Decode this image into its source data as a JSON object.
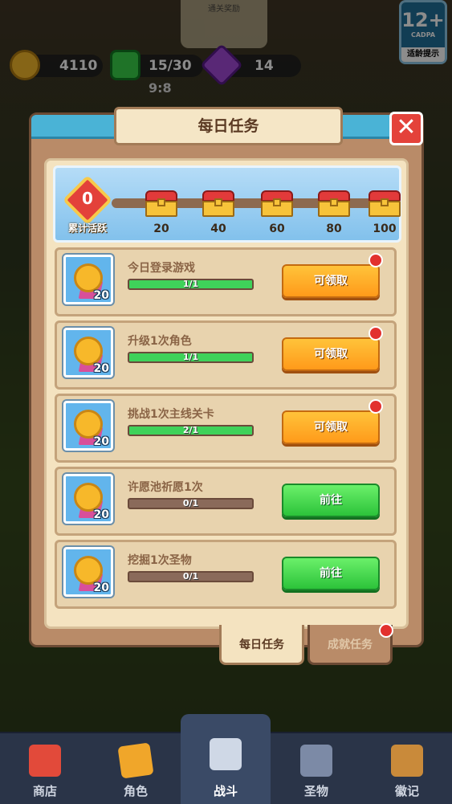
{
  "hud": {
    "gold": "4110",
    "energy": "15/30",
    "gems": "14",
    "timer": "9:8",
    "reward_hint": "通关奖励",
    "age_rating": "12+",
    "age_org": "CADPA",
    "age_tip": "适龄提示"
  },
  "dialog": {
    "title": "每日任务",
    "close_glyph": "✕"
  },
  "activity": {
    "current": "0",
    "label": "累计活跃",
    "milestones": [
      "20",
      "40",
      "60",
      "80",
      "100"
    ]
  },
  "tasks": [
    {
      "name": "今日登录游戏",
      "progress": "1/1",
      "fraction": 1.0,
      "reward": "20",
      "button": "可领取",
      "state": "claimable"
    },
    {
      "name": "升级1次角色",
      "progress": "1/1",
      "fraction": 1.0,
      "reward": "20",
      "button": "可领取",
      "state": "claimable"
    },
    {
      "name": "挑战1次主线关卡",
      "progress": "2/1",
      "fraction": 1.0,
      "reward": "20",
      "button": "可领取",
      "state": "claimable"
    },
    {
      "name": "许愿池祈愿1次",
      "progress": "0/1",
      "fraction": 0.0,
      "reward": "20",
      "button": "前往",
      "state": "goto"
    },
    {
      "name": "挖掘1次圣物",
      "progress": "0/1",
      "fraction": 0.0,
      "reward": "20",
      "button": "前往",
      "state": "goto"
    }
  ],
  "tabs": {
    "daily": "每日任务",
    "achievement": "成就任务"
  },
  "nav": {
    "shop": "商店",
    "character": "角色",
    "battle": "战斗",
    "relic": "圣物",
    "badge": "徽记"
  },
  "colors": {
    "claim_button": "#ff9a1a",
    "goto_button": "#2cc33a",
    "progress_fill": "#3fd25a",
    "notification_dot": "#e2312e"
  }
}
